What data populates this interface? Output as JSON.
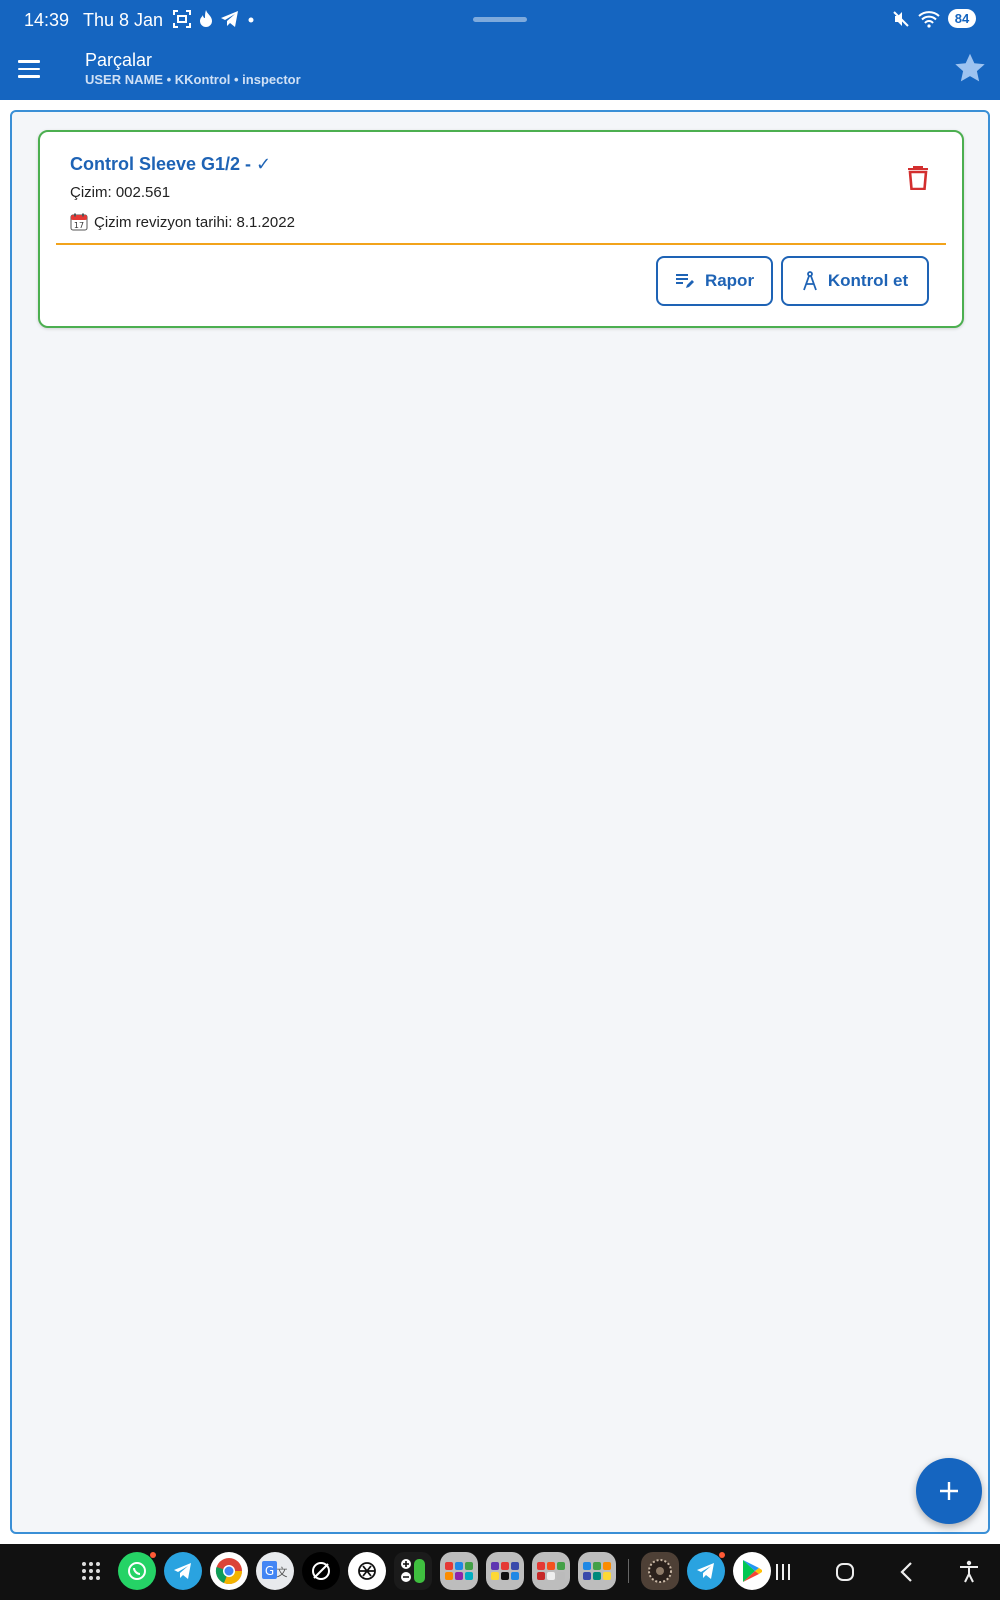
{
  "status_bar": {
    "time": "14:39",
    "date": "Thu 8 Jan",
    "battery": "84",
    "icons_left": [
      "screenshot-icon",
      "flame-icon",
      "telegram-icon",
      "dot-icon"
    ],
    "icons_right": [
      "mute-icon",
      "wifi-icon",
      "battery-icon"
    ]
  },
  "app_bar": {
    "title": "Parçalar",
    "subtitle": "USER NAME • KKontrol • inspector",
    "menu_icon": "menu-icon",
    "action_icon": "star-icon"
  },
  "parts": [
    {
      "title": "Control Sleeve G1/2 - ✓",
      "drawing": "Çizim: 002.561",
      "revision_date": "Çizim revizyon tarihi: 8.1.2022",
      "report_label": "Rapor",
      "check_label": "Kontrol et",
      "delete_icon": "trash-icon"
    }
  ],
  "fab": {
    "icon": "plus-icon"
  },
  "colors": {
    "primary": "#1565c0",
    "card_border": "#4caf50",
    "divider": "#f2a31b",
    "delete": "#d32f2f",
    "list_frame": "#3a8fd6"
  },
  "nav_bar": {
    "dock_apps": [
      "whatsapp-icon",
      "telegram-icon",
      "chrome-icon",
      "translate-icon",
      "app-icon",
      "chatgpt-icon",
      "calculator-icon",
      "folder-icon",
      "folder-icon",
      "folder-icon",
      "folder-icon",
      "wallpaper-icon",
      "telegram-icon",
      "play-store-icon"
    ],
    "system_buttons": [
      "recents-icon",
      "home-icon",
      "back-icon",
      "accessibility-icon"
    ]
  }
}
